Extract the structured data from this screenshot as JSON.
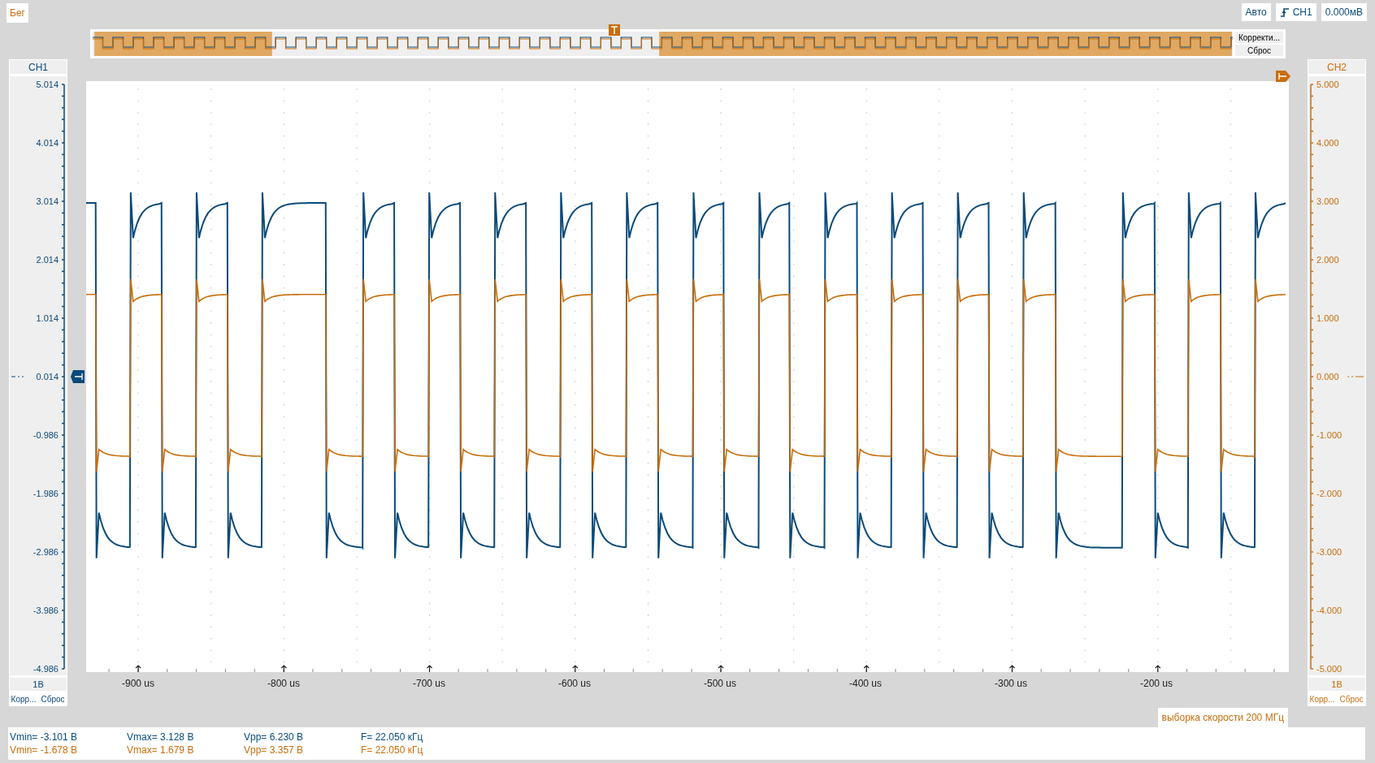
{
  "run_status": "Бег",
  "toolbar": {
    "mode": "Авто",
    "trigger_source": "CH1",
    "trigger_level": "0.000мВ"
  },
  "overview": {
    "buttons": [
      "Корректи...",
      "Сброс"
    ]
  },
  "channels": [
    {
      "label": "CH1",
      "color": "#0b4a7a",
      "ticks": [
        "5.014",
        "4.014",
        "3.014",
        "2.014",
        "1.014",
        "0.014",
        "-0.986",
        "-1.986",
        "-2.986",
        "-3.986",
        "-4.986"
      ],
      "scale": "1В",
      "buttons": [
        "Корр...",
        "Сброс"
      ]
    },
    {
      "label": "CH2",
      "color": "#c86e0c",
      "ticks": [
        "5.000",
        "4.000",
        "3.000",
        "2.000",
        "1.000",
        "0.000",
        "-1.000",
        "-2.000",
        "-3.000",
        "-4.000",
        "-5.000"
      ],
      "scale": "1В",
      "buttons": [
        "Корр...",
        "Сброс"
      ]
    }
  ],
  "x_axis": {
    "labels": [
      "-900 us",
      "-800 us",
      "-700 us",
      "-600 us",
      "-500 us",
      "-400 us",
      "-300 us",
      "-200 us"
    ]
  },
  "sample_rate": "выборка скорости 200 МГц",
  "measurements": [
    {
      "color": "#0b4a7a",
      "values": [
        "Vmin= -3.101 В",
        "Vmax= 3.128 В",
        "Vpp= 6.230 В",
        "F= 22.050 кГц"
      ]
    },
    {
      "color": "#c86e0c",
      "values": [
        "Vmin= -1.678 В",
        "Vmax= 1.679 В",
        "Vpp= 3.357 В",
        "F= 22.050 кГц"
      ]
    }
  ]
}
